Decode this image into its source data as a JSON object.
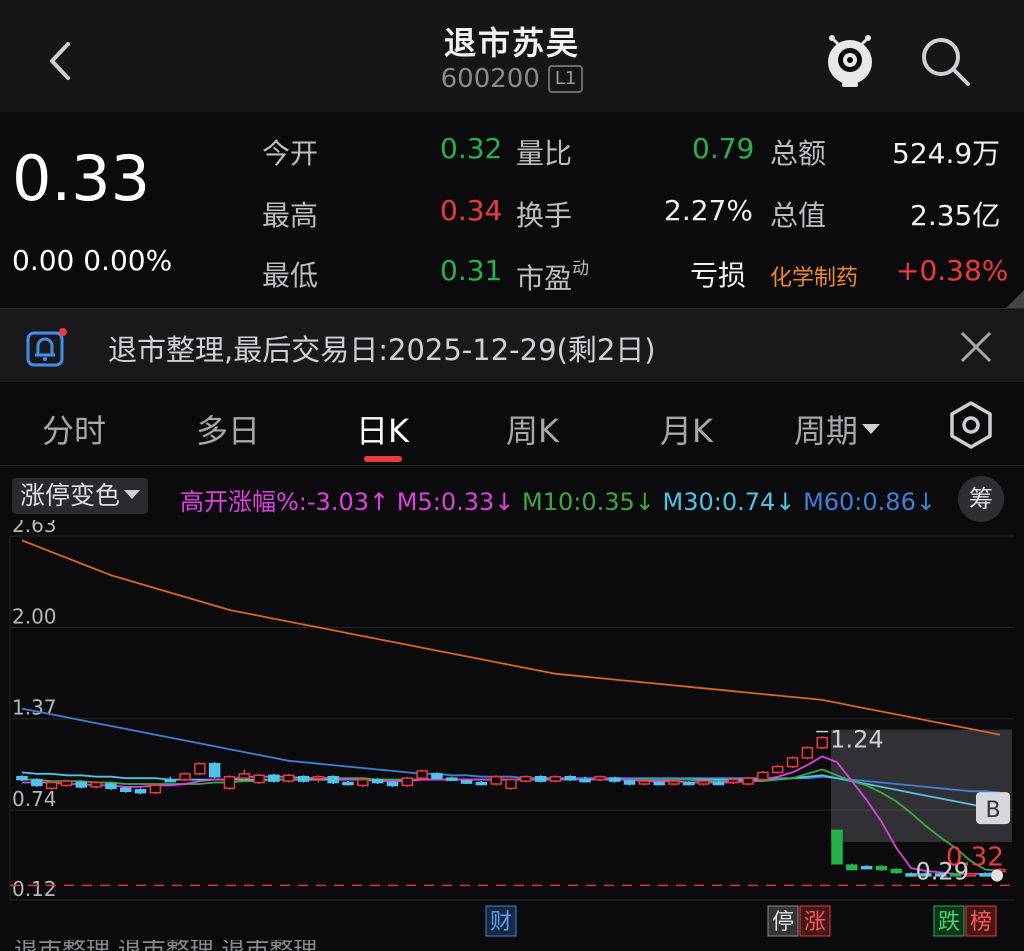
{
  "header": {
    "title": "退市苏吴",
    "code": "600200",
    "level": "L1"
  },
  "quote": {
    "price": "0.33",
    "change": "0.00 0.00%",
    "fields": [
      {
        "label": "今开",
        "value": "0.32",
        "color": "green"
      },
      {
        "label": "量比",
        "value": "0.79",
        "color": "green"
      },
      {
        "label": "总额",
        "value": "524.9万",
        "color": "white"
      },
      {
        "label": "最高",
        "value": "0.34",
        "color": "red"
      },
      {
        "label": "换手",
        "value": "2.27%",
        "color": "white"
      },
      {
        "label": "总值",
        "value": "2.35亿",
        "color": "white"
      },
      {
        "label": "最低",
        "value": "0.31",
        "color": "green"
      },
      {
        "label": "市盈",
        "label_sup": "动",
        "value": "亏损",
        "color": "white"
      },
      {
        "label": "化学制药",
        "value": "+0.38%",
        "color": "red"
      }
    ]
  },
  "notice": {
    "text": "退市整理,最后交易日:2025-12-29(剩2日)"
  },
  "tabs": [
    "分时",
    "多日",
    "日K",
    "周K",
    "月K",
    "周期"
  ],
  "indicators": {
    "selector": "涨停变色",
    "gap": "高开涨幅%:-3.03↑",
    "m5": "M5:0.33↓",
    "m10": "M10:0.35↓",
    "m30": "M30:0.74↓",
    "m60": "M60:0.86↓",
    "chip": "筹"
  },
  "colors": {
    "up": "#ee3a3a",
    "down": "#25b24a",
    "flat": "#4fc3e8",
    "m5": "#e040e0",
    "m10": "#3ea83e",
    "m30": "#4fc3e8",
    "m60": "#3f7fd8",
    "m120": "#d8662a"
  },
  "chart_data": {
    "type": "candlestick",
    "y_ticks": [
      "2.63",
      "2.00",
      "1.37",
      "0.74",
      "0.12"
    ],
    "ylim": [
      0.12,
      2.63
    ],
    "annotations": {
      "high": "1.24",
      "low": "0.29",
      "last": "0.32",
      "marker": "B"
    },
    "event_tags": [
      {
        "text": "财",
        "style": "blue"
      },
      {
        "text": "停",
        "style": "gray"
      },
      {
        "text": "涨",
        "style": "red"
      },
      {
        "text": "跌",
        "style": "green"
      },
      {
        "text": "榜",
        "style": "red"
      }
    ],
    "candles": [
      [
        0.97,
        0.95,
        0.98,
        0.94
      ],
      [
        0.95,
        0.91,
        0.96,
        0.9
      ],
      [
        0.89,
        0.93,
        0.94,
        0.88
      ],
      [
        0.91,
        0.94,
        0.95,
        0.9
      ],
      [
        0.93,
        0.9,
        0.94,
        0.89
      ],
      [
        0.9,
        0.93,
        0.94,
        0.89
      ],
      [
        0.92,
        0.89,
        0.93,
        0.88
      ],
      [
        0.89,
        0.87,
        0.9,
        0.86
      ],
      [
        0.88,
        0.86,
        0.89,
        0.85
      ],
      [
        0.86,
        0.91,
        0.92,
        0.85
      ],
      [
        0.95,
        0.95,
        0.97,
        0.94
      ],
      [
        0.95,
        0.99,
        1.0,
        0.94
      ],
      [
        0.99,
        1.06,
        1.07,
        0.98
      ],
      [
        1.06,
        0.97,
        1.07,
        0.96
      ],
      [
        0.89,
        0.97,
        0.98,
        0.88
      ],
      [
        0.96,
        0.99,
        1.02,
        0.95
      ],
      [
        0.93,
        0.98,
        0.99,
        0.92
      ],
      [
        0.98,
        0.94,
        0.99,
        0.93
      ],
      [
        0.94,
        0.98,
        0.99,
        0.93
      ],
      [
        0.97,
        0.94,
        0.98,
        0.93
      ],
      [
        0.96,
        0.97,
        0.98,
        0.93
      ],
      [
        0.97,
        0.93,
        0.98,
        0.92
      ],
      [
        0.93,
        0.92,
        0.94,
        0.91
      ],
      [
        0.91,
        0.95,
        0.96,
        0.9
      ],
      [
        0.95,
        0.93,
        0.96,
        0.92
      ],
      [
        0.93,
        0.91,
        0.94,
        0.9
      ],
      [
        0.91,
        0.96,
        0.97,
        0.9
      ],
      [
        0.96,
        1.01,
        1.02,
        0.95
      ],
      [
        0.99,
        0.96,
        1.0,
        0.95
      ],
      [
        0.96,
        0.95,
        0.97,
        0.94
      ],
      [
        0.94,
        0.93,
        0.95,
        0.92
      ],
      [
        0.93,
        0.92,
        0.94,
        0.91
      ],
      [
        0.92,
        0.97,
        0.98,
        0.91
      ],
      [
        0.89,
        0.95,
        0.96,
        0.88
      ],
      [
        0.94,
        0.97,
        0.98,
        0.93
      ],
      [
        0.97,
        0.94,
        0.98,
        0.93
      ],
      [
        0.94,
        0.97,
        0.98,
        0.93
      ],
      [
        0.97,
        0.95,
        0.98,
        0.94
      ],
      [
        0.95,
        0.95,
        0.97,
        0.93
      ],
      [
        0.95,
        0.97,
        0.98,
        0.94
      ],
      [
        0.96,
        0.94,
        0.97,
        0.93
      ],
      [
        0.94,
        0.92,
        0.95,
        0.91
      ],
      [
        0.92,
        0.94,
        0.95,
        0.91
      ],
      [
        0.93,
        0.92,
        0.94,
        0.91
      ],
      [
        0.92,
        0.94,
        0.95,
        0.91
      ],
      [
        0.93,
        0.92,
        0.94,
        0.91
      ],
      [
        0.92,
        0.94,
        0.95,
        0.91
      ],
      [
        0.93,
        0.93,
        0.95,
        0.92
      ],
      [
        0.93,
        0.95,
        0.96,
        0.92
      ],
      [
        0.92,
        0.96,
        0.97,
        0.91
      ],
      [
        0.95,
        1.0,
        1.01,
        0.94
      ],
      [
        1.0,
        1.04,
        1.05,
        0.99
      ],
      [
        1.04,
        1.1,
        1.11,
        1.03
      ],
      [
        1.1,
        1.17,
        1.18,
        1.09
      ],
      [
        1.17,
        1.24,
        1.25,
        1.16
      ],
      [
        0.6,
        0.37,
        0.6,
        0.37
      ],
      [
        0.36,
        0.33,
        0.37,
        0.33
      ],
      [
        0.35,
        0.35,
        0.36,
        0.34
      ],
      [
        0.35,
        0.33,
        0.36,
        0.32
      ],
      [
        0.33,
        0.31,
        0.34,
        0.3
      ],
      [
        0.3,
        0.3,
        0.31,
        0.3
      ],
      [
        0.3,
        0.3,
        0.31,
        0.29
      ],
      [
        0.3,
        0.3,
        0.31,
        0.29
      ],
      [
        0.3,
        0.29,
        0.3,
        0.29
      ],
      [
        0.29,
        0.3,
        0.31,
        0.29
      ],
      [
        0.3,
        0.3,
        0.31,
        0.29
      ],
      [
        0.32,
        0.33,
        0.34,
        0.31
      ]
    ],
    "ma": {
      "m5": [
        0.93,
        0.93,
        0.93,
        0.92,
        0.92,
        0.91,
        0.91,
        0.9,
        0.9,
        0.91,
        0.91,
        0.92,
        0.94,
        0.95,
        0.95,
        0.97,
        0.97,
        0.97,
        0.97,
        0.96,
        0.96,
        0.96,
        0.95,
        0.95,
        0.94,
        0.94,
        0.94,
        0.95,
        0.95,
        0.95,
        0.95,
        0.95,
        0.95,
        0.95,
        0.95,
        0.95,
        0.95,
        0.95,
        0.95,
        0.95,
        0.95,
        0.95,
        0.94,
        0.94,
        0.94,
        0.93,
        0.93,
        0.93,
        0.93,
        0.94,
        0.95,
        0.97,
        1.0,
        1.05,
        1.11,
        1.07,
        0.94,
        0.81,
        0.66,
        0.48,
        0.34,
        0.32,
        0.31,
        0.3,
        0.3,
        0.3,
        0.31
      ],
      "m10": [
        0.95,
        0.95,
        0.94,
        0.94,
        0.94,
        0.93,
        0.93,
        0.92,
        0.92,
        0.92,
        0.92,
        0.92,
        0.92,
        0.93,
        0.93,
        0.94,
        0.94,
        0.95,
        0.95,
        0.96,
        0.96,
        0.96,
        0.96,
        0.96,
        0.95,
        0.95,
        0.95,
        0.95,
        0.95,
        0.95,
        0.95,
        0.95,
        0.95,
        0.95,
        0.95,
        0.95,
        0.95,
        0.95,
        0.95,
        0.95,
        0.95,
        0.95,
        0.95,
        0.95,
        0.95,
        0.95,
        0.94,
        0.94,
        0.94,
        0.94,
        0.94,
        0.95,
        0.96,
        0.99,
        1.02,
        0.98,
        0.94,
        0.91,
        0.86,
        0.8,
        0.72,
        0.63,
        0.55,
        0.48,
        0.39,
        0.33,
        0.32
      ],
      "m30": [
        1.0,
        0.99,
        0.99,
        0.98,
        0.98,
        0.97,
        0.97,
        0.96,
        0.96,
        0.96,
        0.95,
        0.95,
        0.95,
        0.95,
        0.95,
        0.95,
        0.95,
        0.95,
        0.95,
        0.95,
        0.95,
        0.95,
        0.95,
        0.95,
        0.95,
        0.95,
        0.95,
        0.95,
        0.95,
        0.95,
        0.95,
        0.95,
        0.95,
        0.95,
        0.95,
        0.95,
        0.95,
        0.95,
        0.95,
        0.95,
        0.95,
        0.95,
        0.95,
        0.95,
        0.95,
        0.95,
        0.95,
        0.95,
        0.95,
        0.95,
        0.95,
        0.95,
        0.96,
        0.97,
        0.98,
        0.96,
        0.94,
        0.92,
        0.9,
        0.88,
        0.86,
        0.84,
        0.82,
        0.8,
        0.78,
        0.76,
        0.74
      ],
      "m60": [
        1.44,
        1.42,
        1.4,
        1.38,
        1.36,
        1.34,
        1.32,
        1.3,
        1.28,
        1.26,
        1.24,
        1.22,
        1.2,
        1.18,
        1.16,
        1.14,
        1.12,
        1.1,
        1.08,
        1.07,
        1.06,
        1.05,
        1.04,
        1.03,
        1.02,
        1.01,
        1.0,
        0.99,
        0.99,
        0.98,
        0.98,
        0.97,
        0.97,
        0.97,
        0.96,
        0.96,
        0.96,
        0.96,
        0.96,
        0.96,
        0.96,
        0.96,
        0.96,
        0.96,
        0.96,
        0.96,
        0.96,
        0.96,
        0.96,
        0.96,
        0.96,
        0.96,
        0.96,
        0.96,
        0.97,
        0.96,
        0.95,
        0.94,
        0.93,
        0.92,
        0.91,
        0.9,
        0.89,
        0.88,
        0.87,
        0.87,
        0.86
      ],
      "m120": [
        2.6,
        2.56,
        2.52,
        2.48,
        2.44,
        2.4,
        2.36,
        2.33,
        2.3,
        2.27,
        2.24,
        2.21,
        2.18,
        2.15,
        2.12,
        2.1,
        2.08,
        2.06,
        2.04,
        2.02,
        2.0,
        1.98,
        1.96,
        1.94,
        1.92,
        1.9,
        1.88,
        1.86,
        1.84,
        1.82,
        1.8,
        1.78,
        1.76,
        1.74,
        1.72,
        1.7,
        1.68,
        1.67,
        1.66,
        1.65,
        1.64,
        1.63,
        1.62,
        1.61,
        1.6,
        1.59,
        1.58,
        1.57,
        1.56,
        1.55,
        1.54,
        1.53,
        1.52,
        1.51,
        1.5,
        1.48,
        1.46,
        1.44,
        1.42,
        1.4,
        1.38,
        1.36,
        1.34,
        1.32,
        1.3,
        1.28,
        1.26
      ]
    }
  },
  "footer": {
    "text": "退市整理 退市整理 退市整理"
  }
}
